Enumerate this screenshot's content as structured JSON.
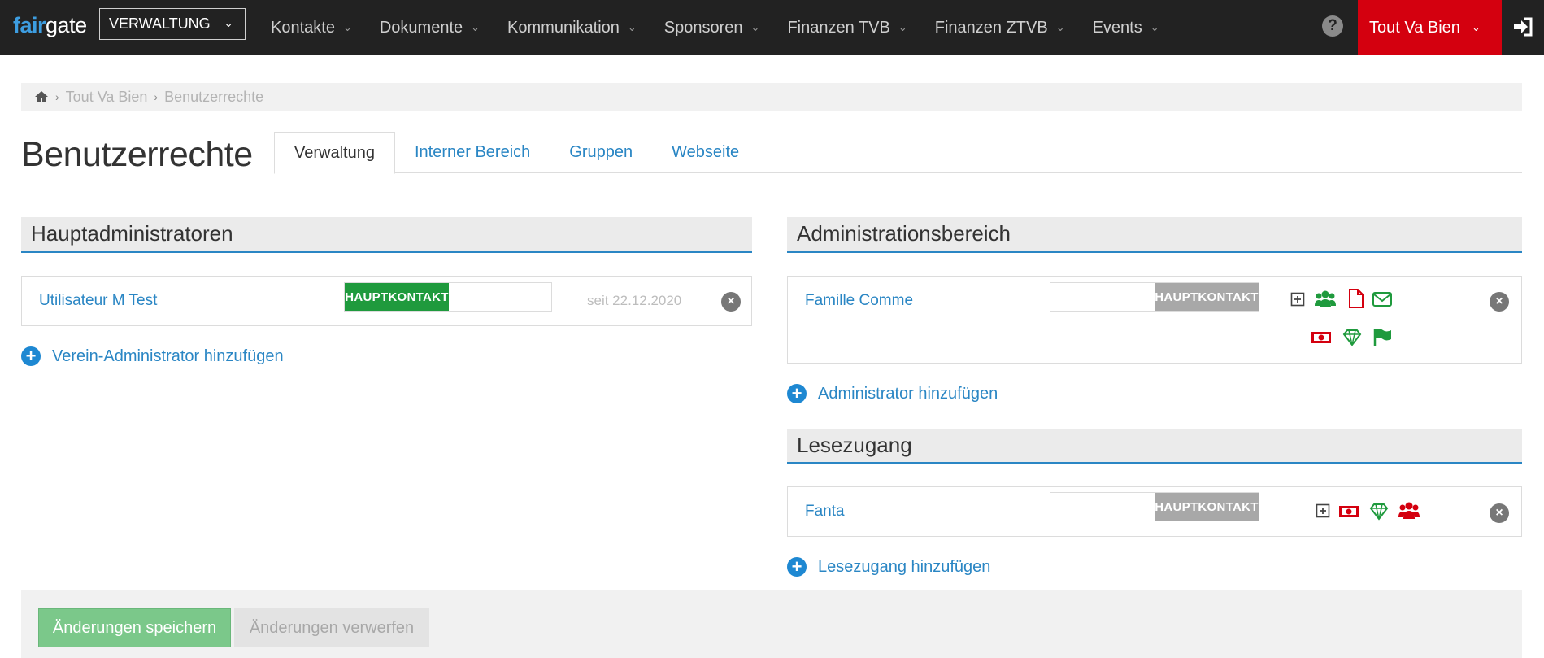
{
  "topbar": {
    "logo_part1": "fair",
    "logo_part2": "gate",
    "module_select": "VERWALTUNG",
    "nav": [
      {
        "label": "Kontakte"
      },
      {
        "label": "Dokumente"
      },
      {
        "label": "Kommunikation"
      },
      {
        "label": "Sponsoren"
      },
      {
        "label": "Finanzen TVB"
      },
      {
        "label": "Finanzen ZTVB"
      },
      {
        "label": "Events"
      }
    ],
    "help_symbol": "?",
    "organization": "Tout Va Bien",
    "accent_color": "#d4000f"
  },
  "breadcrumb": {
    "items": [
      "Tout Va Bien",
      "Benutzerrechte"
    ],
    "home_icon": "home-icon"
  },
  "page": {
    "title": "Benutzerrechte",
    "tabs": [
      {
        "label": "Verwaltung",
        "active": true
      },
      {
        "label": "Interner Bereich",
        "active": false
      },
      {
        "label": "Gruppen",
        "active": false
      },
      {
        "label": "Webseite",
        "active": false
      }
    ]
  },
  "main_admins": {
    "heading": "Hauptadministratoren",
    "entries": [
      {
        "name": "Utilisateur M Test",
        "badge": "HAUPTKONTAKT",
        "since": "seit 22.12.2020"
      }
    ],
    "add_label": "Verein-Administrator hinzufügen"
  },
  "admin_area": {
    "heading": "Administrationsbereich",
    "entries": [
      {
        "name": "Famille Comme",
        "badge": "HAUPTKONTAKT",
        "icons": [
          "expand-icon",
          "contacts-group-icon",
          "document-icon",
          "mail-icon",
          "finance-icon",
          "sponsor-diamond-icon",
          "events-flag-icon"
        ]
      }
    ],
    "add_label": "Administrator hinzufügen"
  },
  "read_access": {
    "heading": "Lesezugang",
    "entries": [
      {
        "name": "Fanta",
        "badge": "HAUPTKONTAKT",
        "icons": [
          "expand-icon",
          "finance-icon",
          "sponsor-diamond-icon",
          "contacts-group-icon"
        ]
      }
    ],
    "add_label": "Lesezugang hinzufügen"
  },
  "footer": {
    "save_label": "Änderungen speichern",
    "discard_label": "Änderungen verwerfen"
  },
  "colors": {
    "link": "#2a86c4",
    "badge_active": "#1f9a3d",
    "badge_inactive": "#a8a8a8",
    "icon_green": "#1f9a3d",
    "icon_red": "#d4000f",
    "save_button": "#7bc88a"
  }
}
